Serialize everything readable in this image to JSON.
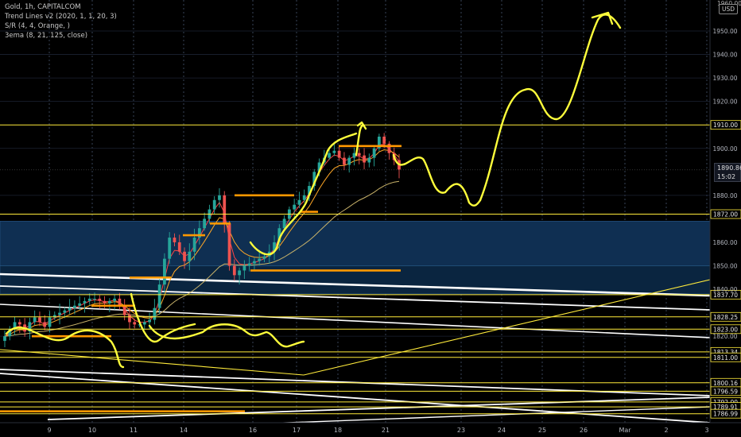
{
  "legend": {
    "symbol": "Gold, 1h, CAPITALCOM",
    "indicator_1": "Trend Lines v2 (2020, 1, 1, 20, 3)",
    "indicator_2": "S/R (4, 4, Orange, )",
    "indicator_3": "3ema (8, 21, 125, close)"
  },
  "currency_badge": "USD",
  "top_price_label": "1960.00",
  "current_price": {
    "value": "1890.86",
    "countdown": "15:02"
  },
  "colors": {
    "background": "#000000",
    "up_candle": "#26a69a",
    "down_candle": "#ef5350",
    "sr_line": "#ffeb3b",
    "zone_fill": "#0d2b4a",
    "orange_level": "#ff9800",
    "annotation": "#ffff3b",
    "trendline": "#ffffff",
    "ema_fast": "#ff4444",
    "ema_mid": "#ffa726",
    "ema_slow": "#c9b36a"
  },
  "chart_data": {
    "type": "candlestick",
    "x_tick_labels": [
      "9",
      "10",
      "11",
      "14",
      "16",
      "17",
      "18",
      "21",
      "23",
      "24",
      "25",
      "26",
      "Mar",
      "2",
      "3"
    ],
    "y_axis": {
      "range": [
        1784,
        1962
      ],
      "tick_labels": [
        "1950.00",
        "1940.00",
        "1930.00",
        "1920.00",
        "1900.00",
        "1880.00",
        "1860.00",
        "1850.00",
        "1840.00",
        "1820.00"
      ]
    },
    "support_resistance_levels": [
      {
        "value": 1910.0,
        "label": "1910.00"
      },
      {
        "value": 1872.0,
        "label": "1872.00"
      },
      {
        "value": 1837.7,
        "label": "1837.70"
      },
      {
        "value": 1828.25,
        "label": "1828.25"
      },
      {
        "value": 1823.0,
        "label": "1823.00"
      },
      {
        "value": 1813.34,
        "label": "1813.34"
      },
      {
        "value": 1811.0,
        "label": "1811.00"
      },
      {
        "value": 1800.16,
        "label": "1800.16"
      },
      {
        "value": 1796.59,
        "label": "1796.59"
      },
      {
        "value": 1792.0,
        "label": "1792.00"
      },
      {
        "value": 1789.91,
        "label": "1789.91"
      },
      {
        "value": 1786.99,
        "label": "1786.99"
      }
    ],
    "zones": [
      [
        1850,
        1869
      ],
      [
        1838,
        1850
      ]
    ],
    "close_path": [
      1820,
      1823,
      1826,
      1825,
      1822,
      1826,
      1828,
      1826,
      1824,
      1828,
      1829,
      1830,
      1831,
      1832,
      1833,
      1834,
      1835,
      1836,
      1836,
      1835,
      1834,
      1835,
      1836,
      1833,
      1829,
      1826,
      1825,
      1825,
      1826,
      1827,
      1832,
      1842,
      1853,
      1862,
      1860,
      1856,
      1852,
      1856,
      1862,
      1866,
      1870,
      1874,
      1878,
      1880,
      1868,
      1850,
      1846,
      1848,
      1850,
      1851,
      1852,
      1853,
      1854,
      1856,
      1860,
      1866,
      1870,
      1874,
      1876,
      1878,
      1880,
      1884,
      1890,
      1894,
      1896,
      1898,
      1899,
      1896,
      1893,
      1896,
      1898,
      1897,
      1894,
      1896,
      1900,
      1905,
      1902,
      1898,
      1895,
      1891
    ],
    "orange_levels": [
      {
        "y": 1820,
        "x_range": [
          40,
          140
        ]
      },
      {
        "y": 1845,
        "x_range": [
          163,
          215
        ]
      },
      {
        "y": 1833,
        "x_range": [
          115,
          170
        ]
      },
      {
        "y": 1863,
        "x_range": [
          230,
          258
        ]
      },
      {
        "y": 1868,
        "x_range": [
          264,
          290
        ]
      },
      {
        "y": 1880,
        "x_range": [
          295,
          370
        ]
      },
      {
        "y": 1848,
        "x_range": [
          315,
          504
        ]
      },
      {
        "y": 1873,
        "x_range": [
          378,
          400
        ]
      },
      {
        "y": 1901,
        "x_range": [
          426,
          505
        ]
      },
      {
        "y": 1788,
        "x_range": [
          0,
          308
        ]
      }
    ]
  }
}
